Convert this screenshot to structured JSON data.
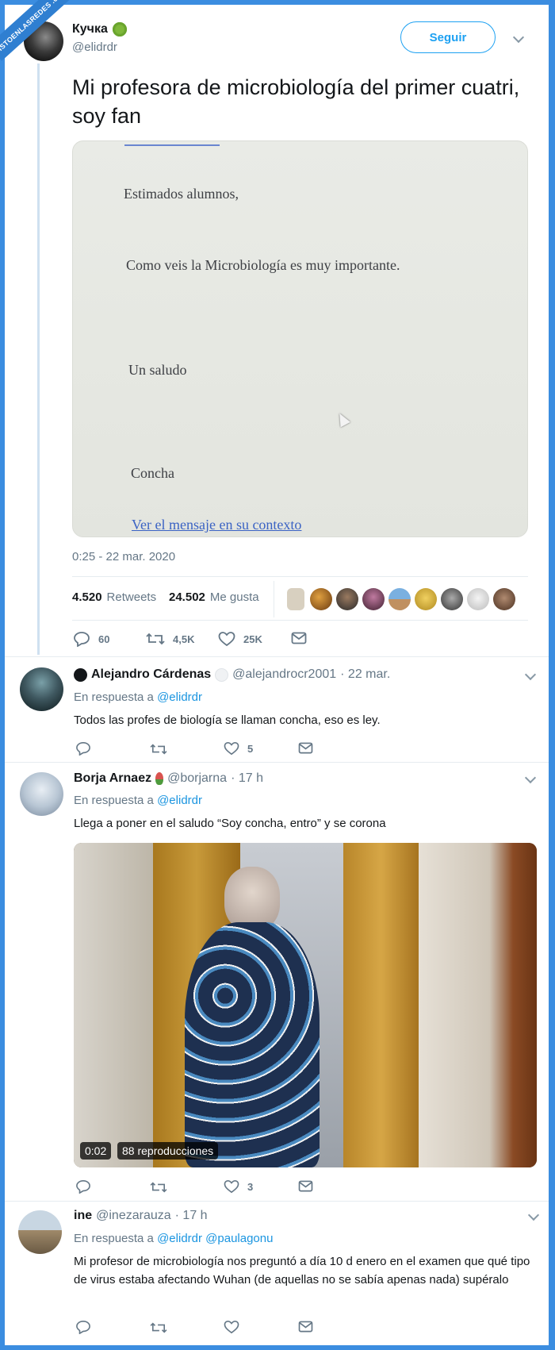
{
  "watermark": "VISTOENLASREDES .com",
  "main_tweet": {
    "user_name": "Кучка",
    "handle": "@elidrdr",
    "follow_label": "Seguir",
    "text": "Mi profesora de microbiología del primer cuatri, soy fan",
    "letter": {
      "greeting": "Estimados alumnos,",
      "body": "Como veis la Microbiología es muy importante.",
      "closing": "Un saludo",
      "signature": "Concha",
      "link": "Ver el mensaje en su contexto"
    },
    "timestamp": "0:25 - 22 mar. 2020",
    "retweets_count": "4.520",
    "retweets_label": "Retweets",
    "likes_count": "24.502",
    "likes_label": "Me gusta",
    "actions": {
      "replies": "60",
      "retweets": "4,5K",
      "likes": "25K"
    }
  },
  "replies": [
    {
      "user_name": "Alejandro Cárdenas",
      "handle": "@alejandrocr2001",
      "time": "· 22 mar.",
      "reply_prefix": "En respuesta a",
      "reply_to": "@elidrdr",
      "text": "Todos las profes de biología se llaman concha, eso es ley.",
      "likes": "5"
    },
    {
      "user_name": "Borja Arnaez",
      "handle": "@borjarna",
      "time": "· 17 h",
      "reply_prefix": "En respuesta a",
      "reply_to": "@elidrdr",
      "text": "Llega a poner en el saludo “Soy concha, entro” y se corona",
      "video_time": "0:02",
      "video_views": "88 reproducciones",
      "likes": "3"
    },
    {
      "user_name": "ine",
      "handle": "@inezarauza",
      "time": "· 17 h",
      "reply_prefix": "En respuesta a",
      "reply_to": "@elidrdr @paulagonu",
      "text": "Mi profesor de microbiología nos preguntó a día 10 d enero en el examen que qué tipo de virus estaba afectando Wuhan (de aquellas no se sabía apenas nada) supéralo"
    }
  ]
}
